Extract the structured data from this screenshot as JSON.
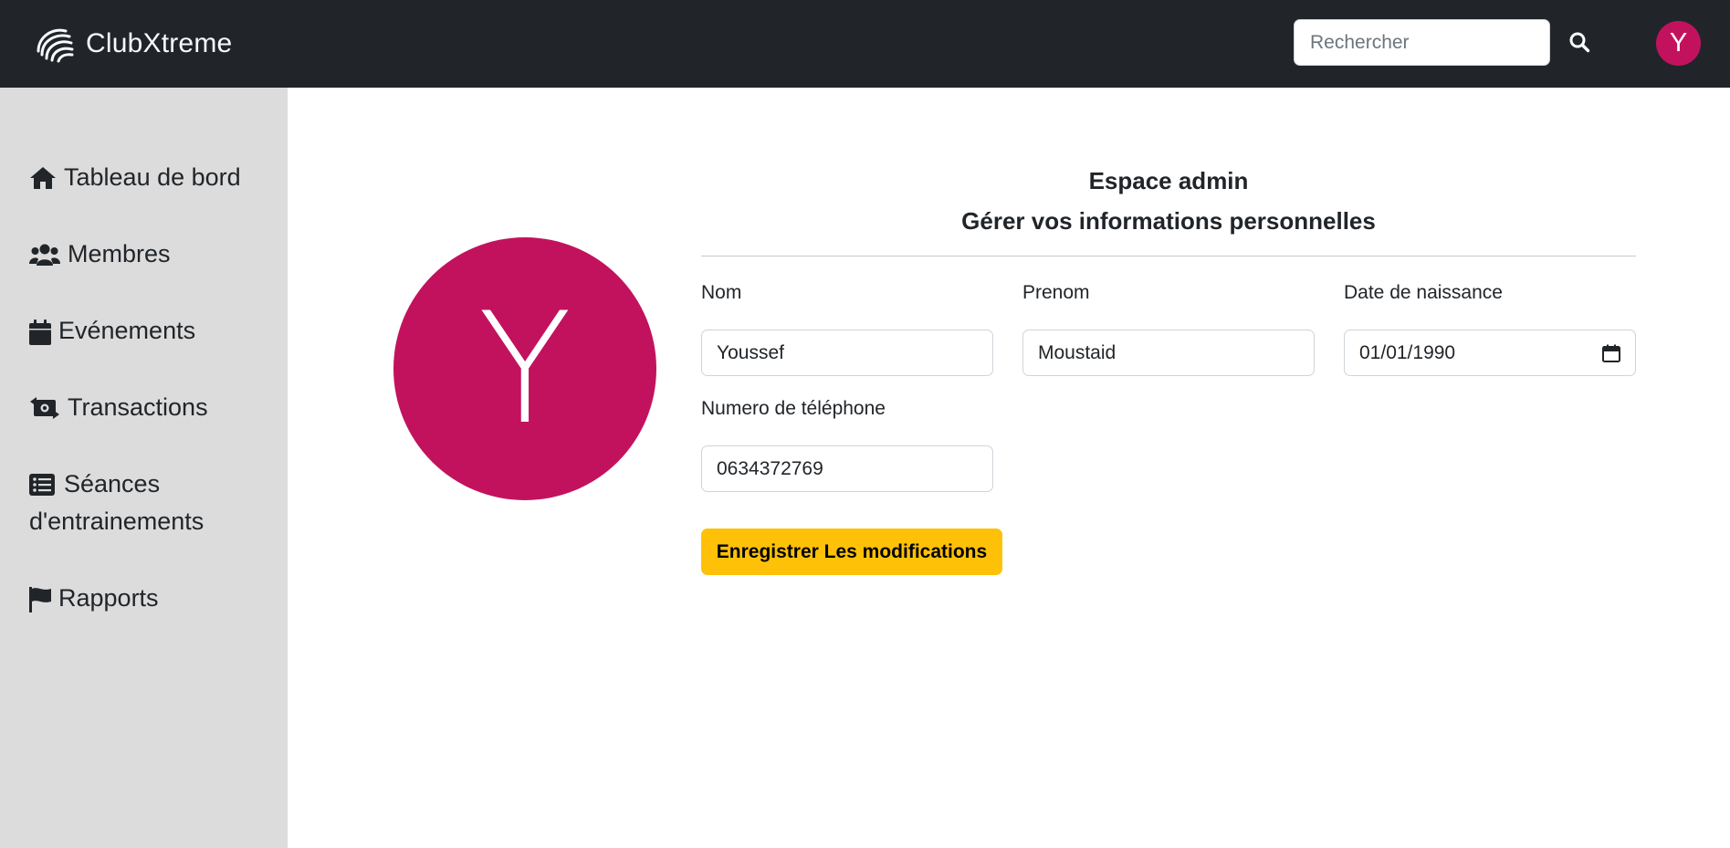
{
  "app": {
    "brand_name": "ClubXtreme",
    "brand_icon": "spiral-logo-icon",
    "accent_color": "#c2125e",
    "navbar_color": "#212529",
    "sidebar_color": "#dcdcdc",
    "button_color": "#ffc107"
  },
  "header": {
    "search_placeholder": "Rechercher",
    "search_icon": "search-icon",
    "avatar_initial": "Y"
  },
  "sidebar": {
    "items": [
      {
        "label": "Tableau de bord",
        "icon": "home-icon"
      },
      {
        "label": "Membres",
        "icon": "users-icon"
      },
      {
        "label": "Evénements",
        "icon": "calendar-icon"
      },
      {
        "label": "Transactions",
        "icon": "money-exchange-icon"
      },
      {
        "label": "Séances d'entrainements",
        "icon": "list-icon"
      },
      {
        "label": "Rapports",
        "icon": "flag-icon"
      }
    ]
  },
  "main": {
    "profile_initial": "Y",
    "title": "Espace admin",
    "subtitle": "Gérer vos informations personnelles",
    "fields": {
      "nom": {
        "label": "Nom",
        "value": "Youssef"
      },
      "prenom": {
        "label": "Prenom",
        "value": "Moustaid"
      },
      "date_naissance": {
        "label": "Date de naissance",
        "value": "01/01/1990",
        "icon": "calendar-picker-icon"
      },
      "telephone": {
        "label": "Numero de téléphone",
        "value": "0634372769"
      }
    },
    "save_label": "Enregistrer Les modifications"
  }
}
